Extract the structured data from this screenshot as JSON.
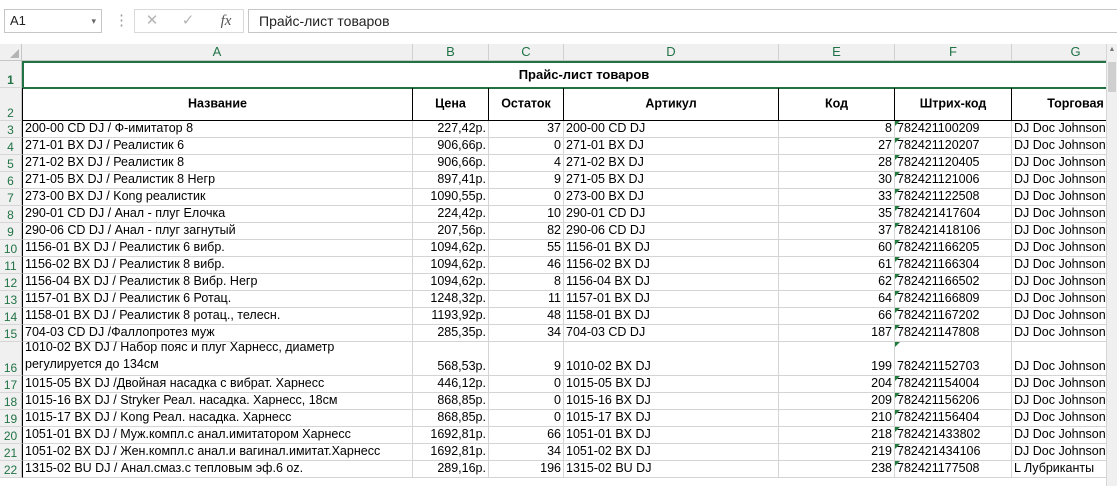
{
  "formula_bar": {
    "name_box": "A1",
    "name_box_dropdown": "▾",
    "cancel_symbol": "✕",
    "enter_symbol": "✓",
    "fx_label": "fx",
    "content": "Прайс-лист товаров"
  },
  "columns": [
    "A",
    "B",
    "C",
    "D",
    "E",
    "F",
    "G"
  ],
  "title": "Прайс-лист товаров",
  "headers": [
    "Название",
    "Цена",
    "Остаток",
    "Артикул",
    "Код",
    "Штрих-код",
    "Торговая"
  ],
  "rows": [
    {
      "num": "3",
      "name": "200-00 CD DJ / Ф-имитатор 8",
      "price": "227,42р.",
      "stock": "37",
      "article": "200-00 CD DJ",
      "code": "8",
      "barcode": "782421100209",
      "brand": "DJ Doc Johnson"
    },
    {
      "num": "4",
      "name": "271-01 BX DJ / Реалистик 6",
      "price": "906,66р.",
      "stock": "0",
      "article": "271-01 BX DJ",
      "code": "27",
      "barcode": "782421120207",
      "brand": "DJ Doc Johnson"
    },
    {
      "num": "5",
      "name": "271-02 BX DJ / Реалистик 8",
      "price": "906,66р.",
      "stock": "4",
      "article": "271-02 BX DJ",
      "code": "28",
      "barcode": "782421120405",
      "brand": "DJ Doc Johnson"
    },
    {
      "num": "6",
      "name": "271-05 BX DJ / Реалистик 8 Негр",
      "price": "897,41р.",
      "stock": "9",
      "article": "271-05 BX DJ",
      "code": "30",
      "barcode": "782421121006",
      "brand": "DJ Doc Johnson"
    },
    {
      "num": "7",
      "name": "273-00 BX DJ / Kong реалистик",
      "price": "1090,55р.",
      "stock": "0",
      "article": "273-00 BX DJ",
      "code": "33",
      "barcode": "782421122508",
      "brand": "DJ Doc Johnson"
    },
    {
      "num": "8",
      "name": "290-01 CD DJ / Анал - плуг Елочка",
      "price": "224,42р.",
      "stock": "10",
      "article": "290-01 CD DJ",
      "code": "35",
      "barcode": "782421417604",
      "brand": "DJ Doc Johnson"
    },
    {
      "num": "9",
      "name": "290-06 CD DJ / Анал - плуг загнутый",
      "price": "207,56р.",
      "stock": "82",
      "article": "290-06 CD DJ",
      "code": "37",
      "barcode": "782421418106",
      "brand": "DJ Doc Johnson"
    },
    {
      "num": "10",
      "name": "1156-01 BX DJ / Реалистик 6 вибр.",
      "price": "1094,62р.",
      "stock": "55",
      "article": "1156-01 BX DJ",
      "code": "60",
      "barcode": "782421166205",
      "brand": "DJ Doc Johnson"
    },
    {
      "num": "11",
      "name": "1156-02 BX DJ / Реалистик 8 вибр.",
      "price": "1094,62р.",
      "stock": "46",
      "article": "1156-02 BX DJ",
      "code": "61",
      "barcode": "782421166304",
      "brand": "DJ Doc Johnson"
    },
    {
      "num": "12",
      "name": "1156-04 BX DJ / Реалистик 8 Вибр. Негр",
      "price": "1094,62р.",
      "stock": "8",
      "article": "1156-04 BX DJ",
      "code": "62",
      "barcode": "782421166502",
      "brand": "DJ Doc Johnson"
    },
    {
      "num": "13",
      "name": "1157-01 BX DJ / Реалистик 6 Ротац.",
      "price": "1248,32р.",
      "stock": "11",
      "article": "1157-01 BX DJ",
      "code": "64",
      "barcode": "782421166809",
      "brand": "DJ Doc Johnson"
    },
    {
      "num": "14",
      "name": "1158-01 BX DJ / Реалистик 8 ротац., телесн.",
      "price": "1193,92р.",
      "stock": "48",
      "article": "1158-01 BX DJ",
      "code": "66",
      "barcode": "782421167202",
      "brand": "DJ Doc Johnson"
    },
    {
      "num": "15",
      "name": "704-03 CD DJ /Фаллопротез муж",
      "price": "285,35р.",
      "stock": "34",
      "article": "704-03 CD DJ",
      "code": "187",
      "barcode": "782421147808",
      "brand": "DJ Doc Johnson"
    },
    {
      "num": "16",
      "name": "1010-02 BX DJ / Набор пояс и плуг Харнесс, диаметр регулируется до 134см",
      "price": "568,53р.",
      "stock": "9",
      "article": "1010-02 BX DJ",
      "code": "199",
      "barcode": "782421152703",
      "brand": "DJ Doc Johnson",
      "tall": true
    },
    {
      "num": "17",
      "name": "1015-05 BX DJ /Двойная насадка с вибрат. Харнесс",
      "price": "446,12р.",
      "stock": "0",
      "article": "1015-05 BX DJ",
      "code": "204",
      "barcode": "782421154004",
      "brand": "DJ Doc Johnson"
    },
    {
      "num": "18",
      "name": "1015-16 BX DJ / Stryker Реал. насадка. Харнесс, 18см",
      "price": "868,85р.",
      "stock": "0",
      "article": "1015-16 BX DJ",
      "code": "209",
      "barcode": "782421156206",
      "brand": "DJ Doc Johnson"
    },
    {
      "num": "19",
      "name": "1015-17 BX DJ / Kong Реал. насадка. Харнесс",
      "price": "868,85р.",
      "stock": "0",
      "article": "1015-17 BX DJ",
      "code": "210",
      "barcode": "782421156404",
      "brand": "DJ Doc Johnson"
    },
    {
      "num": "20",
      "name": "1051-01 BX DJ / Муж.компл.с анал.имитатором Харнесс",
      "price": "1692,81р.",
      "stock": "66",
      "article": "1051-01 BX DJ",
      "code": "218",
      "barcode": "782421433802",
      "brand": "DJ Doc Johnson"
    },
    {
      "num": "21",
      "name": "1051-02 BX DJ / Жен.компл.с анал.и вагинал.имитат.Харнесс",
      "price": "1692,81р.",
      "stock": "34",
      "article": "1051-02 BX DJ",
      "code": "219",
      "barcode": "782421434106",
      "brand": "DJ Doc Johnson"
    },
    {
      "num": "22",
      "name": "1315-02 BU DJ / Анал.смаз.с тепловым эф.6 oz.",
      "price": "289,16р.",
      "stock": "196",
      "article": "1315-02 BU DJ",
      "code": "238",
      "barcode": "782421177508",
      "brand": "L Лубриканты"
    }
  ]
}
